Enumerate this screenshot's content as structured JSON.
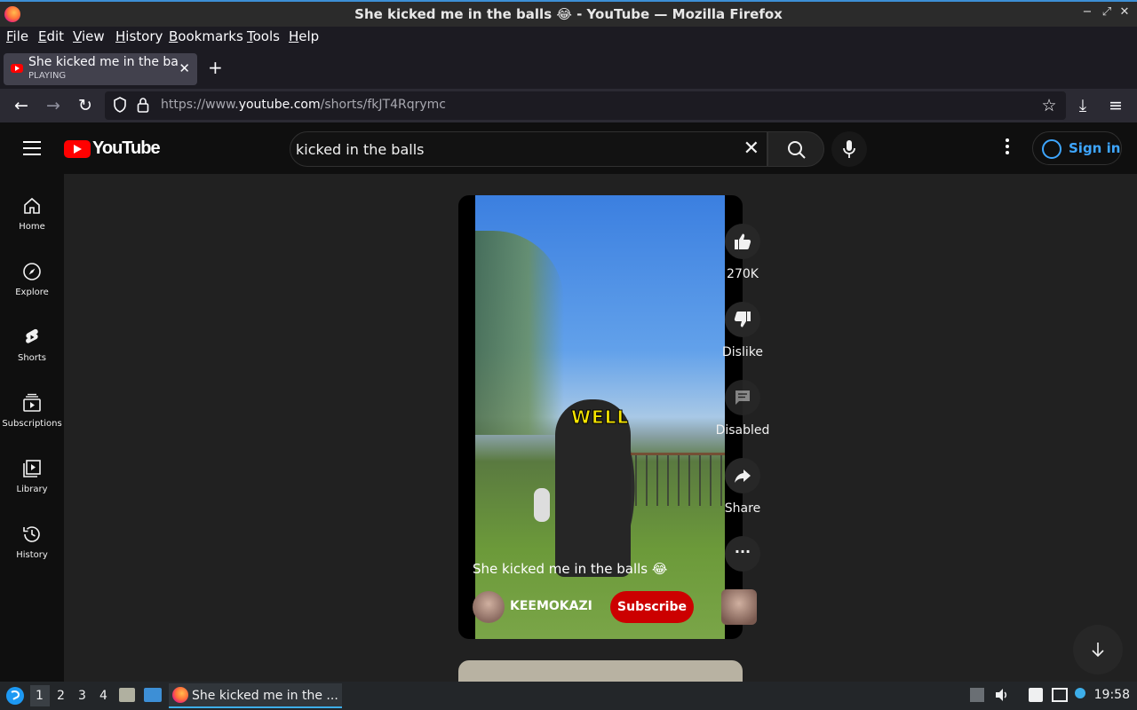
{
  "window": {
    "title": "She kicked me in the balls 😂 - YouTube — Mozilla Firefox",
    "controls": {
      "minimize": "−",
      "restore": "⤢",
      "close": "✕"
    }
  },
  "menu": [
    "File",
    "Edit",
    "View",
    "History",
    "Bookmarks",
    "Tools",
    "Help"
  ],
  "tab": {
    "title": "She kicked me in the balls",
    "status": "PLAYING",
    "close": "✕",
    "new_tab": "+"
  },
  "nav": {
    "back": "←",
    "forward": "→",
    "reload": "↻",
    "url_prefix": "https://www.",
    "url_domain": "youtube.com",
    "url_path": "/shorts/fkJT4Rqrymc",
    "bookmark": "☆",
    "downloads": "⤓",
    "menu": "≡"
  },
  "youtube": {
    "logo_text": "YouTube",
    "search_value": "kicked in the balls",
    "search_clear": "✕",
    "signin": "Sign in",
    "sidebar": [
      {
        "label": "Home",
        "icon": "home-icon"
      },
      {
        "label": "Explore",
        "icon": "compass-icon"
      },
      {
        "label": "Shorts",
        "icon": "shorts-icon"
      },
      {
        "label": "Subscriptions",
        "icon": "subscriptions-icon"
      },
      {
        "label": "Library",
        "icon": "library-icon"
      },
      {
        "label": "History",
        "icon": "history-icon"
      }
    ],
    "short": {
      "overlay_text": "WELL",
      "title": "She kicked me in the balls 😂",
      "channel": "KEEMOKAZI",
      "subscribe": "Subscribe"
    },
    "actions": {
      "likes": "270K",
      "dislike": "Dislike",
      "comments": "Disabled",
      "share": "Share",
      "more": "···"
    }
  },
  "taskbar": {
    "workspaces": [
      "1",
      "2",
      "3",
      "4"
    ],
    "task_title": "She kicked me in the ...",
    "clock": "19:58"
  },
  "colors": {
    "accent": "#3ea6ff",
    "subscribe": "#cc0000",
    "youtube_red": "#ff0000"
  }
}
